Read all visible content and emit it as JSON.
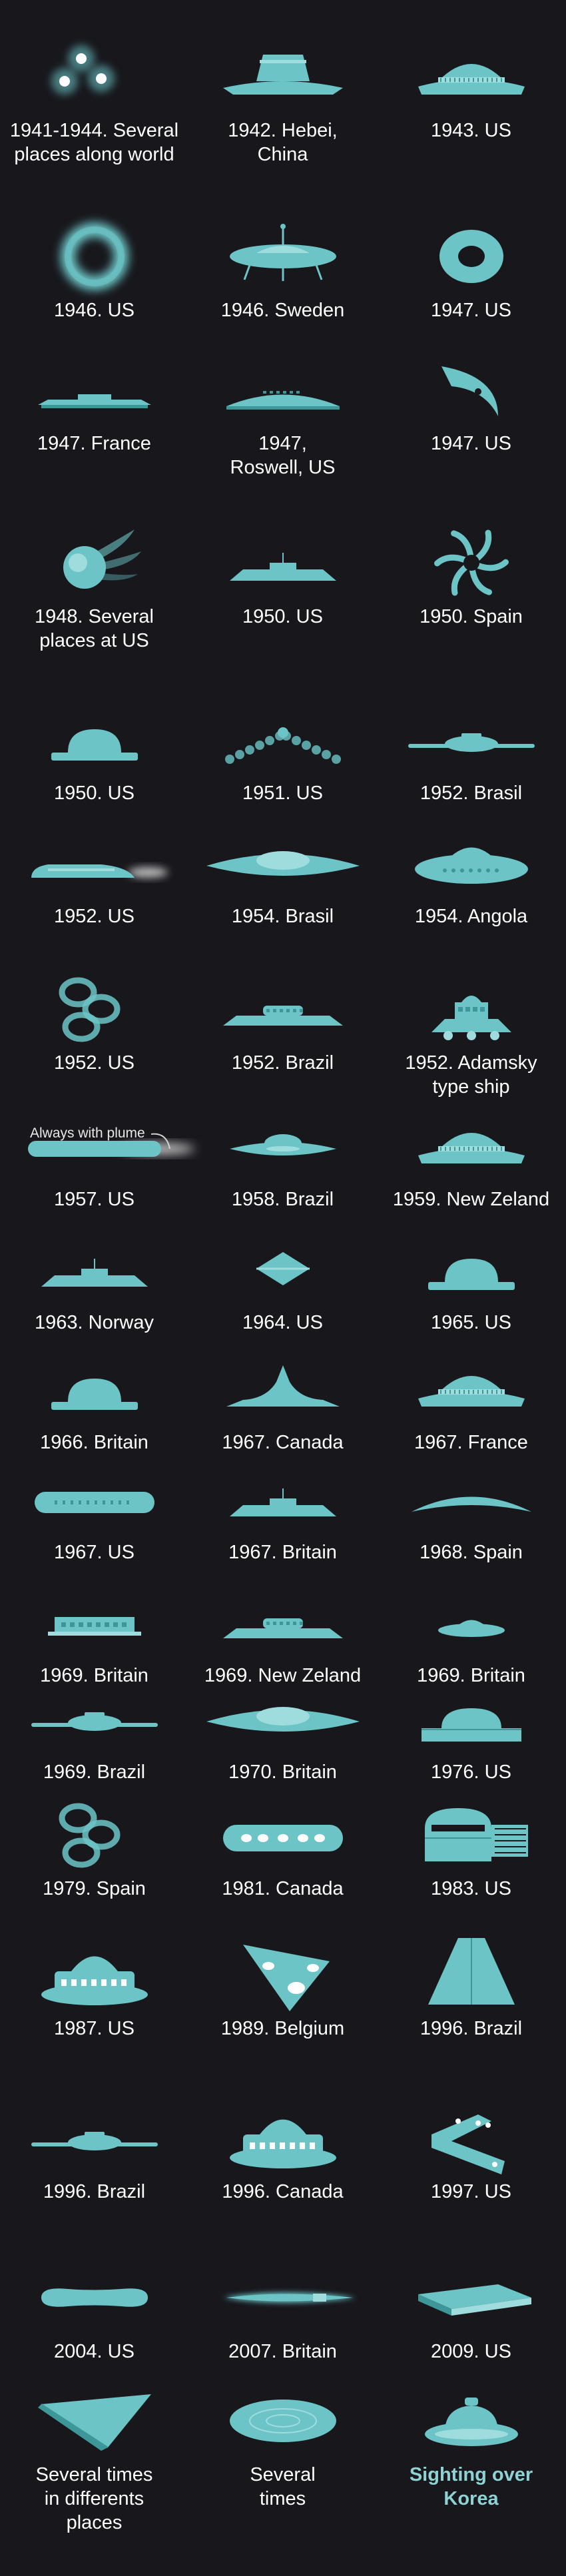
{
  "colors": {
    "background": "#17171c",
    "shape": "#6cc4c6",
    "shape_light": "#9fdcdd",
    "shape_dark": "#3d9799",
    "text": "#ffffff",
    "highlight": "#8fd2d4"
  },
  "note": "Always with plume",
  "items": [
    {
      "label": "1941-1944. Several\nplaces along world",
      "shape": "three-orbs"
    },
    {
      "label": "1942. Hebei,\nChina",
      "shape": "hat-saucer"
    },
    {
      "label": "1943. US",
      "shape": "ribbed-dome-saucer"
    },
    {
      "label": "1946. US",
      "shape": "glow-ring"
    },
    {
      "label": "1946. Sweden",
      "shape": "antenna-saucer"
    },
    {
      "label": "1947. US",
      "shape": "torus"
    },
    {
      "label": "1947. France",
      "shape": "flat-disc"
    },
    {
      "label": "1947,\nRoswell, US",
      "shape": "wide-saucer"
    },
    {
      "label": "1947. US",
      "shape": "crescent"
    },
    {
      "label": "1948. Several\nplaces at US",
      "shape": "comet-orb"
    },
    {
      "label": "1950. US",
      "shape": "flat-saucer"
    },
    {
      "label": "1950. Spain",
      "shape": "swirl"
    },
    {
      "label": "1950. US",
      "shape": "dome"
    },
    {
      "label": "1951. US",
      "shape": "dot-chevron"
    },
    {
      "label": "1952. Brasil",
      "shape": "thin-saucer"
    },
    {
      "label": "1952. US",
      "shape": "jet-saucer"
    },
    {
      "label": "1954. Brasil",
      "shape": "lens"
    },
    {
      "label": "1954. Angola",
      "shape": "bell-saucer"
    },
    {
      "label": "1952. US",
      "shape": "three-rings"
    },
    {
      "label": "1952. Brazil",
      "shape": "windowed-saucer"
    },
    {
      "label": "1952. Adamsky\ntype ship",
      "shape": "adamski"
    },
    {
      "label": "1957. US",
      "shape": "cigar-plume"
    },
    {
      "label": "1958. Brazil",
      "shape": "lens-dome"
    },
    {
      "label": "1959. New Zeland",
      "shape": "ribbed-dome-saucer"
    },
    {
      "label": "1963. Norway",
      "shape": "flat-saucer"
    },
    {
      "label": "1964.  US",
      "shape": "double-diamond"
    },
    {
      "label": "1965. US",
      "shape": "dome"
    },
    {
      "label": "1966. Britain",
      "shape": "dome"
    },
    {
      "label": "1967. Canada",
      "shape": "spike-saucer"
    },
    {
      "label": "1967. France",
      "shape": "ribbed-dome-saucer"
    },
    {
      "label": "1967. US",
      "shape": "capsule"
    },
    {
      "label": "1967. Britain",
      "shape": "flat-saucer"
    },
    {
      "label": "1968. Spain",
      "shape": "arc"
    },
    {
      "label": "1969. Britain",
      "shape": "windowed-block"
    },
    {
      "label": "1969. New Zeland",
      "shape": "windowed-saucer"
    },
    {
      "label": "1969. Britain",
      "shape": "small-saucer"
    },
    {
      "label": "1969. Brazil",
      "shape": "thin-saucer"
    },
    {
      "label": "1970. Britain",
      "shape": "lens"
    },
    {
      "label": "1976. US",
      "shape": "cut-dome"
    },
    {
      "label": "1979. Spain",
      "shape": "three-rings"
    },
    {
      "label": "1981. Canada",
      "shape": "windowed-capsule"
    },
    {
      "label": "1983. US",
      "shape": "dome-grid"
    },
    {
      "label": "1987. US",
      "shape": "tiered-saucer"
    },
    {
      "label": "1989. Belgium",
      "shape": "triangle"
    },
    {
      "label": "1996. Brazil",
      "shape": "pyramid"
    },
    {
      "label": "1996. Brazil",
      "shape": "thin-saucer"
    },
    {
      "label": "1996. Canada",
      "shape": "tiered-saucer"
    },
    {
      "label": "1997.  US",
      "shape": "boomerang"
    },
    {
      "label": "2004. US",
      "shape": "tic-tac"
    },
    {
      "label": "2007. Britain",
      "shape": "glow-cigar"
    },
    {
      "label": "2009. US",
      "shape": "slab"
    },
    {
      "label": "Several times\nin differents\nplaces",
      "shape": "flat-triangle"
    },
    {
      "label": "Several\ntimes",
      "shape": "disc-rings"
    },
    {
      "label": "Sighting over\nKorea",
      "shape": "top-saucer",
      "highlight": true
    }
  ]
}
